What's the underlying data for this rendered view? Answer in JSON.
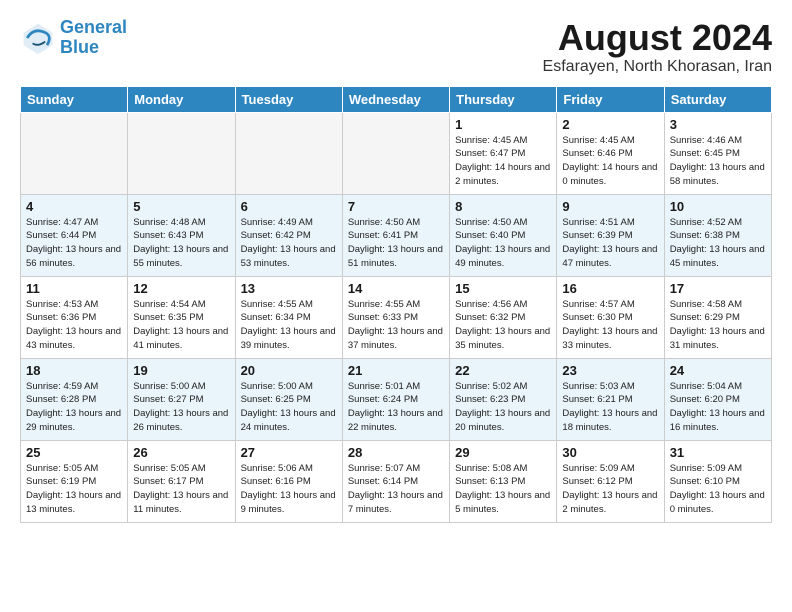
{
  "header": {
    "logo_line1": "General",
    "logo_line2": "Blue",
    "month": "August 2024",
    "location": "Esfarayen, North Khorasan, Iran"
  },
  "weekdays": [
    "Sunday",
    "Monday",
    "Tuesday",
    "Wednesday",
    "Thursday",
    "Friday",
    "Saturday"
  ],
  "weeks": [
    [
      {
        "day": "",
        "info": ""
      },
      {
        "day": "",
        "info": ""
      },
      {
        "day": "",
        "info": ""
      },
      {
        "day": "",
        "info": ""
      },
      {
        "day": "1",
        "info": "Sunrise: 4:45 AM\nSunset: 6:47 PM\nDaylight: 14 hours\nand 2 minutes."
      },
      {
        "day": "2",
        "info": "Sunrise: 4:45 AM\nSunset: 6:46 PM\nDaylight: 14 hours\nand 0 minutes."
      },
      {
        "day": "3",
        "info": "Sunrise: 4:46 AM\nSunset: 6:45 PM\nDaylight: 13 hours\nand 58 minutes."
      }
    ],
    [
      {
        "day": "4",
        "info": "Sunrise: 4:47 AM\nSunset: 6:44 PM\nDaylight: 13 hours\nand 56 minutes."
      },
      {
        "day": "5",
        "info": "Sunrise: 4:48 AM\nSunset: 6:43 PM\nDaylight: 13 hours\nand 55 minutes."
      },
      {
        "day": "6",
        "info": "Sunrise: 4:49 AM\nSunset: 6:42 PM\nDaylight: 13 hours\nand 53 minutes."
      },
      {
        "day": "7",
        "info": "Sunrise: 4:50 AM\nSunset: 6:41 PM\nDaylight: 13 hours\nand 51 minutes."
      },
      {
        "day": "8",
        "info": "Sunrise: 4:50 AM\nSunset: 6:40 PM\nDaylight: 13 hours\nand 49 minutes."
      },
      {
        "day": "9",
        "info": "Sunrise: 4:51 AM\nSunset: 6:39 PM\nDaylight: 13 hours\nand 47 minutes."
      },
      {
        "day": "10",
        "info": "Sunrise: 4:52 AM\nSunset: 6:38 PM\nDaylight: 13 hours\nand 45 minutes."
      }
    ],
    [
      {
        "day": "11",
        "info": "Sunrise: 4:53 AM\nSunset: 6:36 PM\nDaylight: 13 hours\nand 43 minutes."
      },
      {
        "day": "12",
        "info": "Sunrise: 4:54 AM\nSunset: 6:35 PM\nDaylight: 13 hours\nand 41 minutes."
      },
      {
        "day": "13",
        "info": "Sunrise: 4:55 AM\nSunset: 6:34 PM\nDaylight: 13 hours\nand 39 minutes."
      },
      {
        "day": "14",
        "info": "Sunrise: 4:55 AM\nSunset: 6:33 PM\nDaylight: 13 hours\nand 37 minutes."
      },
      {
        "day": "15",
        "info": "Sunrise: 4:56 AM\nSunset: 6:32 PM\nDaylight: 13 hours\nand 35 minutes."
      },
      {
        "day": "16",
        "info": "Sunrise: 4:57 AM\nSunset: 6:30 PM\nDaylight: 13 hours\nand 33 minutes."
      },
      {
        "day": "17",
        "info": "Sunrise: 4:58 AM\nSunset: 6:29 PM\nDaylight: 13 hours\nand 31 minutes."
      }
    ],
    [
      {
        "day": "18",
        "info": "Sunrise: 4:59 AM\nSunset: 6:28 PM\nDaylight: 13 hours\nand 29 minutes."
      },
      {
        "day": "19",
        "info": "Sunrise: 5:00 AM\nSunset: 6:27 PM\nDaylight: 13 hours\nand 26 minutes."
      },
      {
        "day": "20",
        "info": "Sunrise: 5:00 AM\nSunset: 6:25 PM\nDaylight: 13 hours\nand 24 minutes."
      },
      {
        "day": "21",
        "info": "Sunrise: 5:01 AM\nSunset: 6:24 PM\nDaylight: 13 hours\nand 22 minutes."
      },
      {
        "day": "22",
        "info": "Sunrise: 5:02 AM\nSunset: 6:23 PM\nDaylight: 13 hours\nand 20 minutes."
      },
      {
        "day": "23",
        "info": "Sunrise: 5:03 AM\nSunset: 6:21 PM\nDaylight: 13 hours\nand 18 minutes."
      },
      {
        "day": "24",
        "info": "Sunrise: 5:04 AM\nSunset: 6:20 PM\nDaylight: 13 hours\nand 16 minutes."
      }
    ],
    [
      {
        "day": "25",
        "info": "Sunrise: 5:05 AM\nSunset: 6:19 PM\nDaylight: 13 hours\nand 13 minutes."
      },
      {
        "day": "26",
        "info": "Sunrise: 5:05 AM\nSunset: 6:17 PM\nDaylight: 13 hours\nand 11 minutes."
      },
      {
        "day": "27",
        "info": "Sunrise: 5:06 AM\nSunset: 6:16 PM\nDaylight: 13 hours\nand 9 minutes."
      },
      {
        "day": "28",
        "info": "Sunrise: 5:07 AM\nSunset: 6:14 PM\nDaylight: 13 hours\nand 7 minutes."
      },
      {
        "day": "29",
        "info": "Sunrise: 5:08 AM\nSunset: 6:13 PM\nDaylight: 13 hours\nand 5 minutes."
      },
      {
        "day": "30",
        "info": "Sunrise: 5:09 AM\nSunset: 6:12 PM\nDaylight: 13 hours\nand 2 minutes."
      },
      {
        "day": "31",
        "info": "Sunrise: 5:09 AM\nSunset: 6:10 PM\nDaylight: 13 hours\nand 0 minutes."
      }
    ]
  ]
}
